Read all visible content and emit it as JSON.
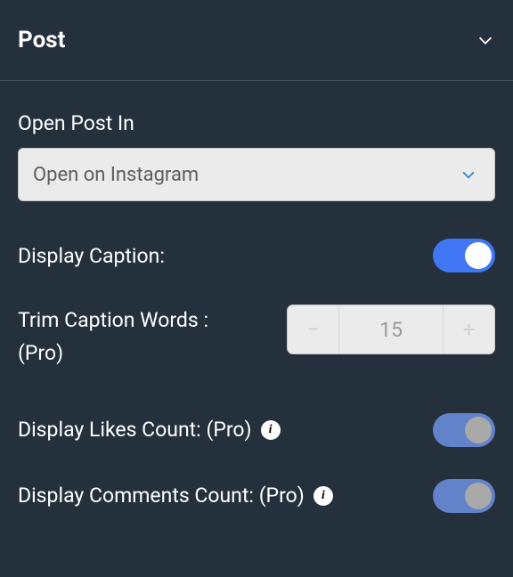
{
  "header": {
    "title": "Post"
  },
  "open_post_in": {
    "label": "Open Post In",
    "selected": "Open on Instagram"
  },
  "display_caption": {
    "label": "Display Caption:",
    "on": true
  },
  "trim_caption": {
    "label_line1": "Trim Caption Words :",
    "label_line2": "(Pro)",
    "value": "15"
  },
  "display_likes": {
    "label": "Display Likes Count: (Pro)",
    "on": true
  },
  "display_comments": {
    "label": "Display Comments Count: (Pro)",
    "on": true
  }
}
